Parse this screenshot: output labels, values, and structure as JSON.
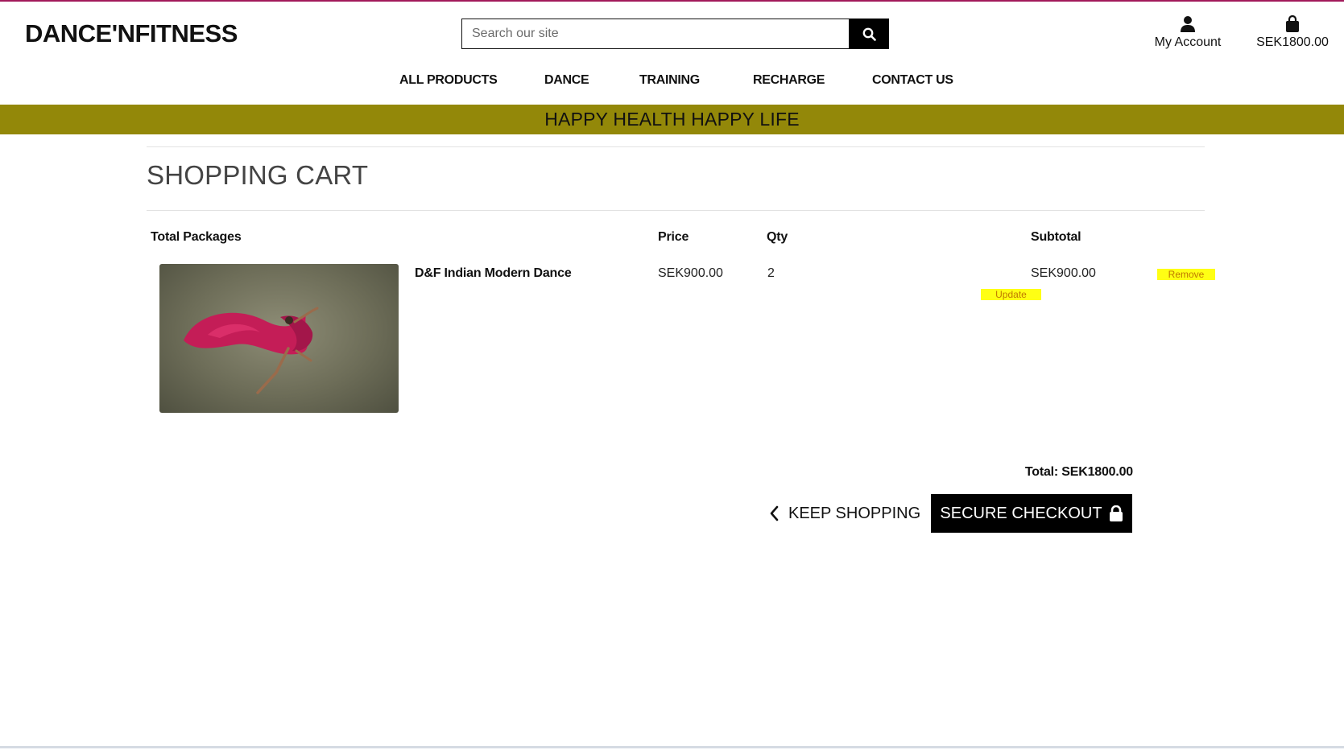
{
  "header": {
    "logo": "DANCE'NFITNESS",
    "search": {
      "placeholder": "Search our site",
      "value": ""
    },
    "account_label": "My Account",
    "bag_total": "SEK1800.00",
    "accent_color": "#a2195a"
  },
  "nav": {
    "items": [
      {
        "label": "ALL PRODUCTS"
      },
      {
        "label": "DANCE"
      },
      {
        "label": "TRAINING"
      },
      {
        "label": "RECHARGE"
      },
      {
        "label": "CONTACT US"
      }
    ]
  },
  "banner": {
    "text": "HAPPY HEALTH HAPPY LIFE",
    "color": "#938809"
  },
  "cart": {
    "title": "SHOPPING CART",
    "columns": {
      "package": "Total Packages",
      "price": "Price",
      "qty": "Qty",
      "subtotal": "Subtotal"
    },
    "items": [
      {
        "name": "D&F Indian Modern Dance",
        "price": "SEK900.00",
        "qty": "2",
        "subtotal": "SEK900.00",
        "image_icon": "dancer-photo",
        "update_label": "Update",
        "remove_label": "Remove"
      }
    ],
    "total": "Total: SEK1800.00",
    "keep_shopping_label": "KEEP SHOPPING",
    "checkout_label": "SECURE CHECKOUT"
  }
}
